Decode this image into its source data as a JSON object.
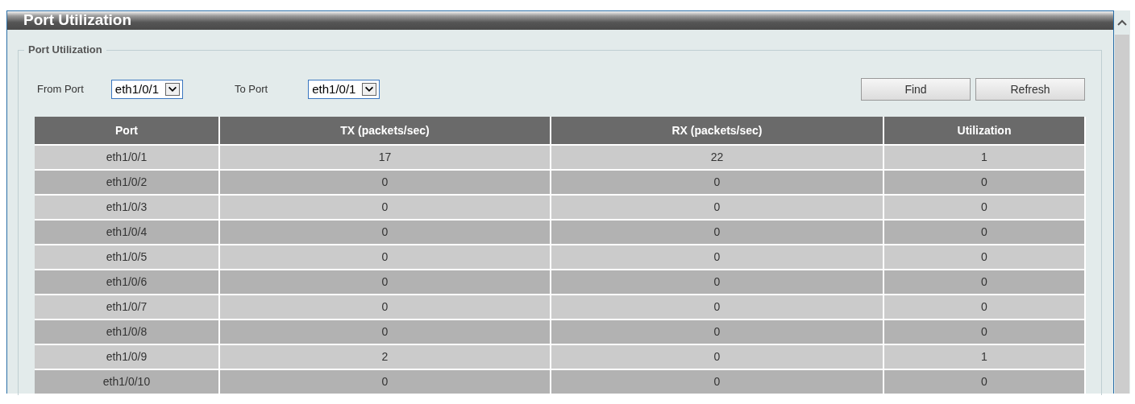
{
  "panel": {
    "title": "Port Utilization"
  },
  "fieldset": {
    "legend": "Port Utilization"
  },
  "filters": [
    {
      "label": "From Port",
      "value": "eth1/0/1"
    },
    {
      "label": "To Port",
      "value": "eth1/0/1"
    }
  ],
  "buttons": [
    "Find",
    "Refresh"
  ],
  "table": {
    "columns": [
      "Port",
      "TX (packets/sec)",
      "RX (packets/sec)",
      "Utilization"
    ],
    "rows": [
      [
        "eth1/0/1",
        "17",
        "22",
        "1"
      ],
      [
        "eth1/0/2",
        "0",
        "0",
        "0"
      ],
      [
        "eth1/0/3",
        "0",
        "0",
        "0"
      ],
      [
        "eth1/0/4",
        "0",
        "0",
        "0"
      ],
      [
        "eth1/0/5",
        "0",
        "0",
        "0"
      ],
      [
        "eth1/0/6",
        "0",
        "0",
        "0"
      ],
      [
        "eth1/0/7",
        "0",
        "0",
        "0"
      ],
      [
        "eth1/0/8",
        "0",
        "0",
        "0"
      ],
      [
        "eth1/0/9",
        "2",
        "0",
        "1"
      ],
      [
        "eth1/0/10",
        "0",
        "0",
        "0"
      ]
    ]
  }
}
